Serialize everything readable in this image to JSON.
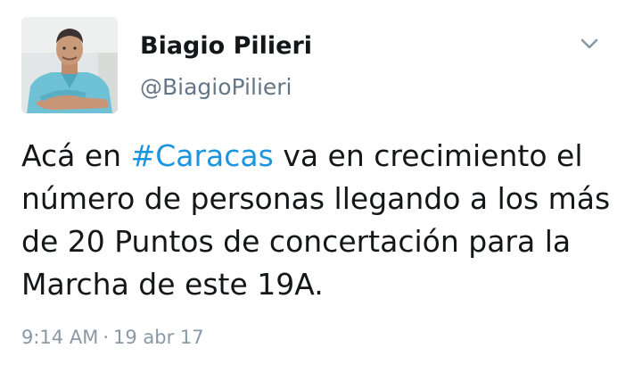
{
  "tweet": {
    "author": {
      "display_name": "Biagio Pilieri",
      "screen_name": "@BiagioPilieri",
      "avatar": "profile-photo"
    },
    "menu_icon": "chevron-down-icon",
    "text_lines": [
      {
        "before": "Acá en ",
        "hashtag": "#Caracas",
        "after": " va en crecimiento el"
      },
      {
        "text": "número de personas llegando a los más"
      },
      {
        "text": "de 20 Puntos de concertación para la"
      },
      {
        "text": "Marcha de este 19A."
      }
    ],
    "time": "9:14 AM",
    "separator": "·",
    "date": "19 abr 17"
  },
  "colors": {
    "text": "#14171a",
    "secondary": "#657786",
    "meta": "#8899a6",
    "hashtag": "#1b95e0"
  }
}
